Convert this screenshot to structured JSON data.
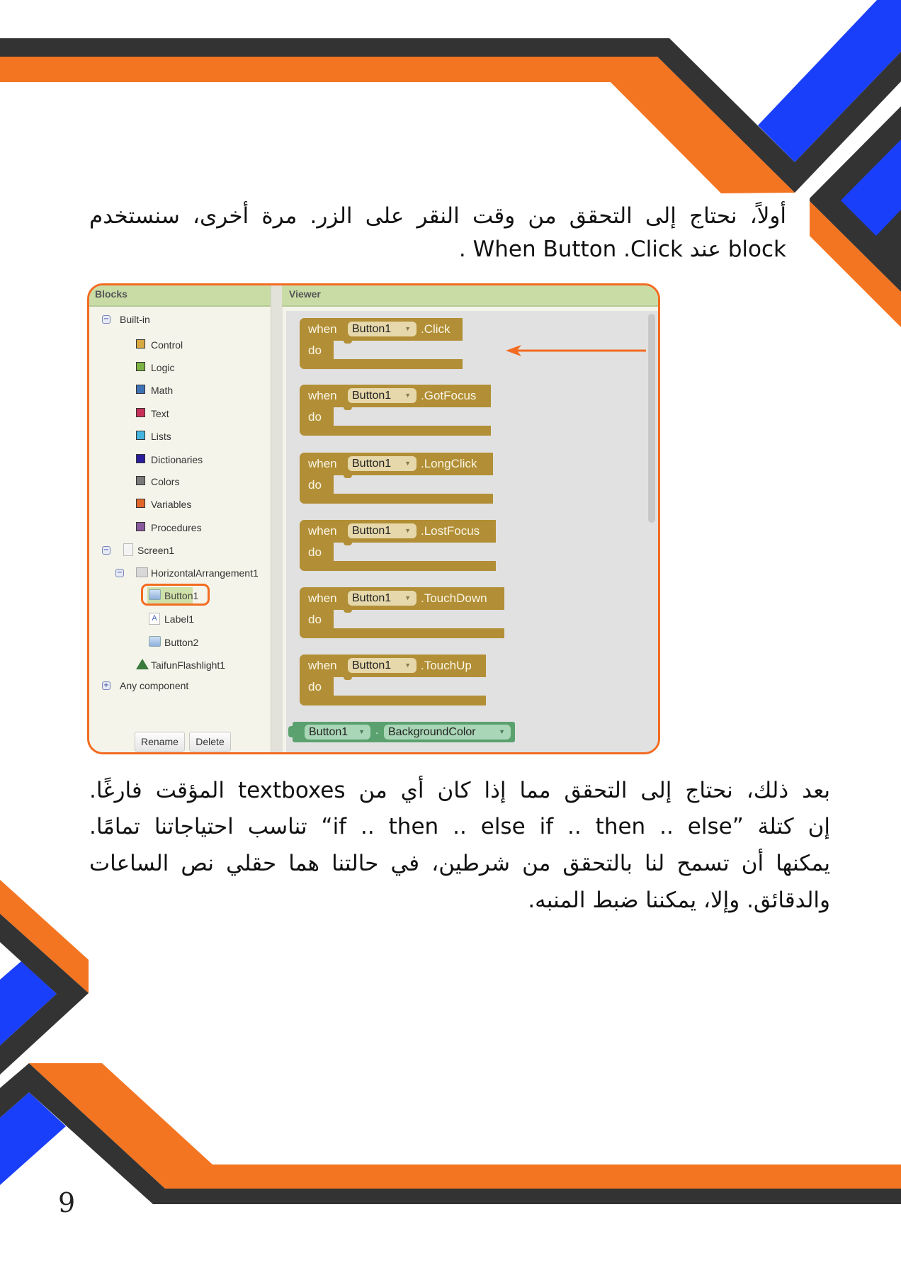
{
  "colors": {
    "orange": "#f47521",
    "dark": "#333333",
    "blue": "#1a3ffb",
    "panel_border": "#f26b21",
    "event_block": "#b28f36",
    "getter_block": "#5ba16f"
  },
  "page": {
    "number": "9"
  },
  "intro": {
    "lines": [
      "أولاً، نحتاج إلى التحقق من وقت النقر على الزر. مرة أخرى، سنستخدم",
      ". When Button .Click عند block"
    ]
  },
  "body": {
    "lines": [
      "بعد ذلك، نحتاج إلى التحقق مما إذا كان أي من textboxes المؤقت فارغًا.",
      "إن كتلة ”if .. then .. else if .. then .. else“ تناسب احتياجاتنا تمامًا.",
      "يمكنها أن تسمح لنا بالتحقق من شرطين، في حالتنا هما حقلي نص الساعات",
      "والدقائق. وإلا، يمكننا ضبط المنبه."
    ]
  },
  "blocks_panel": {
    "header": "Blocks",
    "tree": [
      {
        "label": "Built-in",
        "toggle": "minus"
      },
      {
        "label": "Control",
        "icon": "category-square",
        "color": "#d8a940"
      },
      {
        "label": "Logic",
        "icon": "category-square",
        "color": "#7cb342"
      },
      {
        "label": "Math",
        "icon": "category-square",
        "color": "#3f71b5"
      },
      {
        "label": "Text",
        "icon": "category-square",
        "color": "#c8305a"
      },
      {
        "label": "Lists",
        "icon": "category-square",
        "color": "#45b4de"
      },
      {
        "label": "Dictionaries",
        "icon": "category-square",
        "color": "#2a1e9c"
      },
      {
        "label": "Colors",
        "icon": "category-square",
        "color": "#7a7a7a"
      },
      {
        "label": "Variables",
        "icon": "category-square",
        "color": "#e0662a"
      },
      {
        "label": "Procedures",
        "icon": "category-square",
        "color": "#8a5a9f"
      },
      {
        "label": "Screen1",
        "toggle": "minus",
        "icon": "screen"
      },
      {
        "label": "HorizontalArrangement1",
        "toggle": "minus",
        "icon": "arrangement"
      },
      {
        "label": "Button1",
        "icon": "button",
        "selected": true
      },
      {
        "label": "Label1",
        "icon": "label"
      },
      {
        "label": "Button2",
        "icon": "button"
      },
      {
        "label": "TaifunFlashlight1",
        "icon": "extension"
      },
      {
        "label": "Any component",
        "toggle": "plus"
      }
    ],
    "buttons": {
      "rename": "Rename",
      "delete": "Delete"
    }
  },
  "viewer": {
    "header": "Viewer",
    "event_blocks": [
      {
        "when": "when",
        "component": "Button1",
        "event": ".Click",
        "do": "do"
      },
      {
        "when": "when",
        "component": "Button1",
        "event": ".GotFocus",
        "do": "do"
      },
      {
        "when": "when",
        "component": "Button1",
        "event": ".LongClick",
        "do": "do"
      },
      {
        "when": "when",
        "component": "Button1",
        "event": ".LostFocus",
        "do": "do"
      },
      {
        "when": "when",
        "component": "Button1",
        "event": ".TouchDown",
        "do": "do"
      },
      {
        "when": "when",
        "component": "Button1",
        "event": ".TouchUp",
        "do": "do"
      }
    ],
    "getter": {
      "component": "Button1",
      "separator": ".",
      "property": "BackgroundColor"
    }
  }
}
